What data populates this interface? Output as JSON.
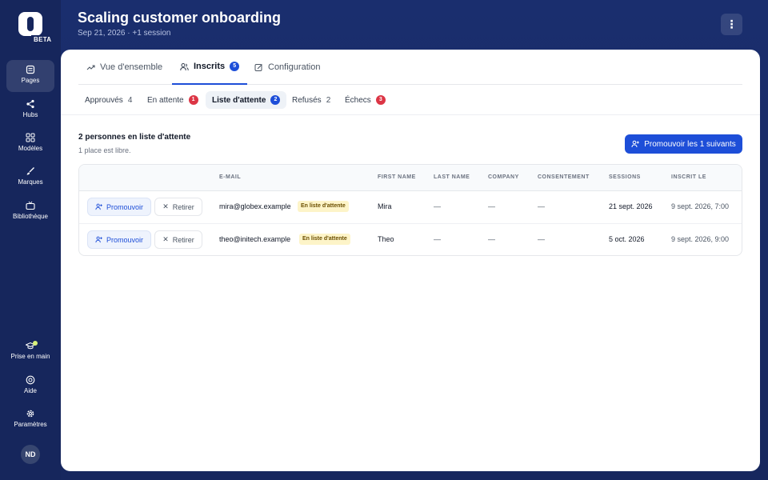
{
  "sidebar": {
    "beta": "BETA",
    "items": [
      {
        "label": "Pages",
        "icon": "pages-icon"
      },
      {
        "label": "Hubs",
        "icon": "share-icon"
      },
      {
        "label": "Modèles",
        "icon": "grid-icon"
      },
      {
        "label": "Marques",
        "icon": "brush-icon"
      },
      {
        "label": "Bibliothèque",
        "icon": "tv-icon"
      }
    ],
    "bottom_items": [
      {
        "label": "Prise en main",
        "icon": "graduation-cap-icon"
      },
      {
        "label": "Aide",
        "icon": "lifebuoy-icon"
      },
      {
        "label": "Paramètres",
        "icon": "gear-icon"
      }
    ],
    "avatar_initials": "ND"
  },
  "header": {
    "title": "Scaling customer onboarding",
    "subtitle": "Sep 21, 2026 · +1 session"
  },
  "tabs": [
    {
      "label": "Vue d'ensemble",
      "icon": "trend-icon"
    },
    {
      "label": "Inscrits",
      "icon": "users-icon",
      "badge": "5"
    },
    {
      "label": "Configuration",
      "icon": "edit-icon"
    }
  ],
  "subtabs": [
    {
      "label": "Approuvés",
      "count": "4"
    },
    {
      "label": "En attente",
      "badge": "1"
    },
    {
      "label": "Liste d'attente",
      "badge": "2"
    },
    {
      "label": "Refusés",
      "count": "2"
    },
    {
      "label": "Échecs",
      "badge": "3"
    }
  ],
  "waitlist": {
    "title": "2 personnes en liste d'attente",
    "subtitle": "1 place est libre.",
    "promote_all_label": "Promouvoir les 1 suivants"
  },
  "table": {
    "columns": [
      "E-MAIL",
      "FIRST NAME",
      "LAST NAME",
      "COMPANY",
      "CONSENTEMENT",
      "SESSIONS",
      "INSCRIT LE"
    ],
    "promote_label": "Promouvoir",
    "remove_label": "Retirer",
    "rows": [
      {
        "email": "mira@globex.example",
        "status": "En liste d'attente",
        "first_name": "Mira",
        "last_name": "—",
        "company": "—",
        "consent": "—",
        "session": "21 sept. 2026",
        "registered": "9 sept. 2026, 7:00"
      },
      {
        "email": "theo@initech.example",
        "status": "En liste d'attente",
        "first_name": "Theo",
        "last_name": "—",
        "company": "—",
        "consent": "—",
        "session": "5 oct. 2026",
        "registered": "9 sept. 2026, 9:00"
      }
    ]
  },
  "colors": {
    "accent": "#1d4ed8",
    "danger": "#dc3545",
    "navy": "#16265c"
  }
}
